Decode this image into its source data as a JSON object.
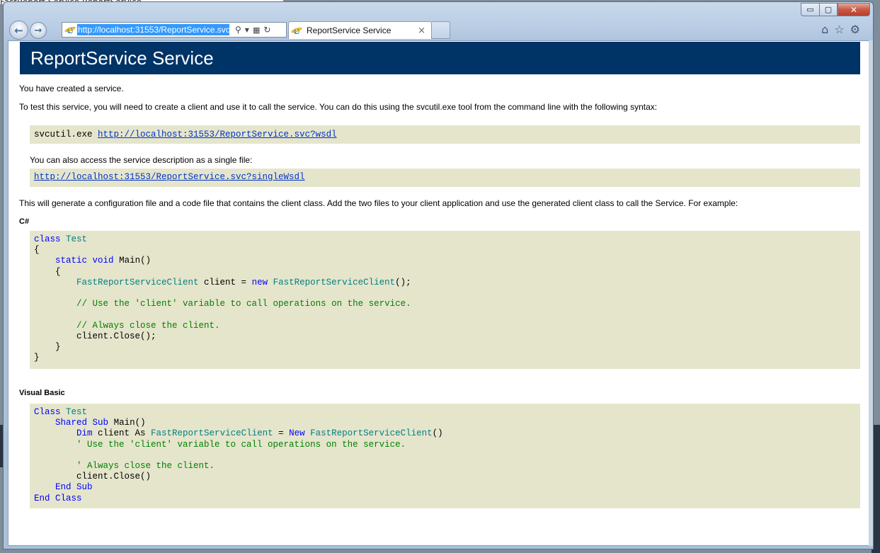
{
  "background_window_title": "FastReport.Service.ReportService",
  "window": {
    "caption_buttons": {
      "minimize": "▭",
      "maximize": "▢",
      "close": "✕"
    }
  },
  "nav": {
    "back_icon": "arrow-left-icon",
    "forward_icon": "arrow-right-icon",
    "url": "http://localhost:31553/ReportService.svc",
    "tab_title": "ReportService Service",
    "tab_close": "×"
  },
  "toolbar_icons": [
    "home-icon",
    "favorites-star-icon",
    "gear-icon"
  ],
  "page": {
    "heading": "ReportService Service",
    "intro": "You have created a service.",
    "test_para": "To test this service, you will need to create a client and use it to call the service. You can do this using the svcutil.exe tool from the command line with the following syntax:",
    "svcutil_cmd": "svcutil.exe ",
    "wsdl_link": "http://localhost:31553/ReportService.svc?wsdl",
    "single_file_para": "You can also access the service description as a single file:",
    "single_wsdl_link": "http://localhost:31553/ReportService.svc?singleWsdl",
    "generate_para": "This will generate a configuration file and a code file that contains the client class. Add the two files to your client application and use the generated client class to call the Service. For example:",
    "csharp_label": "C#",
    "vb_label": "Visual Basic",
    "csharp": {
      "l1_kw": "class",
      "l1_ty": "Test",
      "l2": "{",
      "l3_indent": "    ",
      "l3_kw1": "static",
      "l3_kw2": "void",
      "l3_rest": " Main()",
      "l4": "    {",
      "l5_indent": "        ",
      "l5_ty1": "FastReportServiceClient",
      "l5_mid": " client = ",
      "l5_kw": "new",
      "l5_ty2": "FastReportServiceClient",
      "l5_end": "();",
      "l7": "        // Use the 'client' variable to call operations on the service.",
      "l9": "        // Always close the client.",
      "l10": "        client.Close();",
      "l11": "    }",
      "l12": "}"
    },
    "vb": {
      "l1_kw": "Class",
      "l1_ty": "Test",
      "l2_kw1": "Shared",
      "l2_kw2": "Sub",
      "l2_rest": " Main()",
      "l3_kw": "Dim",
      "l3_mid": " client As ",
      "l3_ty1": "FastReportServiceClient",
      "l3_eq": " = ",
      "l3_kw2": "New",
      "l3_ty2": "FastReportServiceClient",
      "l3_end": "()",
      "l4": "        ' Use the 'client' variable to call operations on the service.",
      "l6": "        ' Always close the client.",
      "l7": "        client.Close()",
      "l8_kw1": "End",
      "l8_kw2": "Sub",
      "l9_kw1": "End",
      "l9_kw2": "Class"
    }
  }
}
